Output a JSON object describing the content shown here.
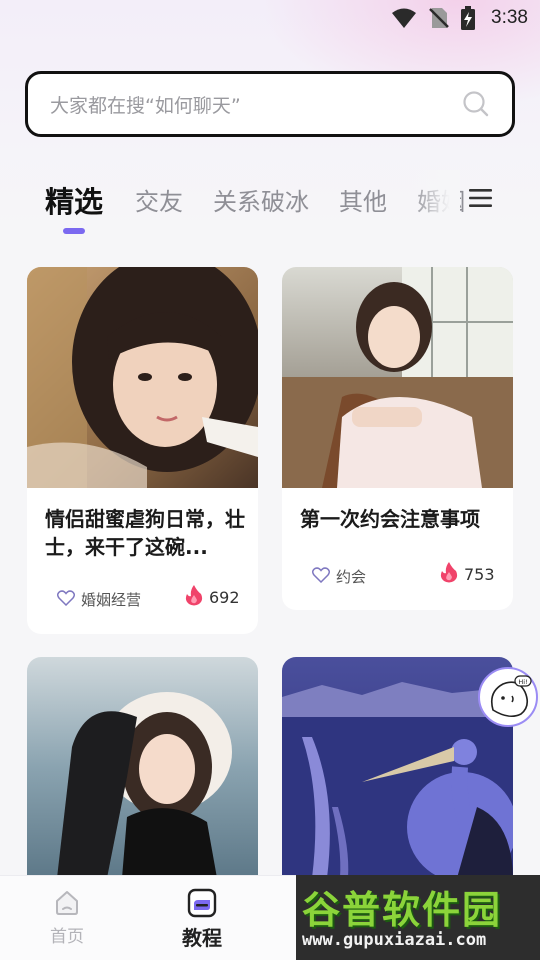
{
  "status_bar": {
    "time": "3:38"
  },
  "search": {
    "placeholder": "大家都在搜“如何聊天”"
  },
  "tabs": [
    {
      "label": "精选",
      "active": true
    },
    {
      "label": "交友"
    },
    {
      "label": "关系破冰"
    },
    {
      "label": "其他"
    },
    {
      "label": "婚姻"
    }
  ],
  "cards": [
    {
      "title": "情侣甜蜜虐狗日常，壮士，来干了这碗...",
      "tag": "婚姻经营",
      "heat": "692"
    },
    {
      "title": "第一次约会注意事项",
      "tag": "约会",
      "heat": "753"
    },
    {
      "title": ""
    },
    {
      "title": ""
    }
  ],
  "float_avatar": {
    "badge": "Hi!"
  },
  "bottom_nav": [
    {
      "label": "首页"
    },
    {
      "label": "教程",
      "active": true
    }
  ],
  "watermark": {
    "main": "谷普软件园",
    "url": "www.gupuxiazai.com"
  },
  "colors": {
    "accent": "#7b69f0",
    "heat": "#f0436a",
    "background": "#f6f6f8"
  }
}
